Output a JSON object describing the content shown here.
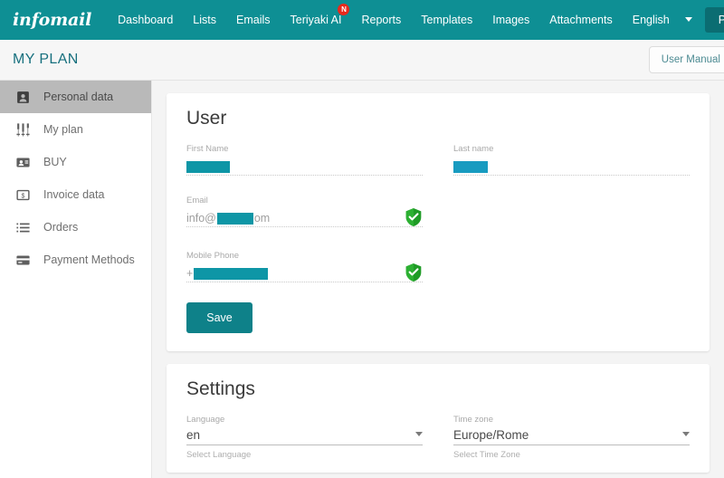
{
  "navbar": {
    "logo": "infomail",
    "items": [
      {
        "label": "Dashboard",
        "badge": ""
      },
      {
        "label": "Lists",
        "badge": ""
      },
      {
        "label": "Emails",
        "badge": ""
      },
      {
        "label": "Teriyaki AI",
        "badge": "N"
      },
      {
        "label": "Reports",
        "badge": ""
      },
      {
        "label": "Templates",
        "badge": ""
      },
      {
        "label": "Images",
        "badge": ""
      },
      {
        "label": "Attachments",
        "badge": ""
      },
      {
        "label": "English",
        "badge": ""
      }
    ],
    "profile_label": "Profile",
    "brand_color": "#0e8f94",
    "profile_color": "#0b6d72",
    "badge_color": "#e8291c"
  },
  "page_header": {
    "title": "MY PLAN",
    "manual_button": "User Manual",
    "title_color": "#17707e"
  },
  "sidebar": {
    "items": [
      {
        "label": "Personal data",
        "icon": "contact-card-icon",
        "active": true
      },
      {
        "label": "My plan",
        "icon": "sliders-icon",
        "active": false
      },
      {
        "label": "BUY",
        "icon": "id-card-icon",
        "active": false
      },
      {
        "label": "Invoice data",
        "icon": "dollar-box-icon",
        "active": false
      },
      {
        "label": "Orders",
        "icon": "list-icon",
        "active": false
      },
      {
        "label": "Payment Methods",
        "icon": "credit-card-icon",
        "active": false
      }
    ],
    "active_bg": "#b9b9b9"
  },
  "user_card": {
    "title": "User",
    "first_name": {
      "label": "First Name",
      "value": "",
      "redacted": true
    },
    "last_name": {
      "label": "Last name",
      "value": "",
      "redacted": true
    },
    "email": {
      "label": "Email",
      "value_prefix": "info@",
      "value_suffix": "om",
      "redacted": true,
      "verified": true,
      "verified_icon": "green-shield-check-icon"
    },
    "mobile_phone": {
      "label": "Mobile Phone",
      "value_prefix": "+",
      "value_suffix": "",
      "redacted": true,
      "verified": true,
      "verified_icon": "green-shield-check-icon"
    },
    "save_label": "Save",
    "save_color": "#0e8189",
    "redaction_color": "#0e96a6",
    "verified_color": "#1f9b26"
  },
  "settings_card": {
    "title": "Settings",
    "language": {
      "label": "Language",
      "value": "en",
      "hint": "Select Language"
    },
    "timezone": {
      "label": "Time zone",
      "value": "Europe/Rome",
      "hint": "Select Time Zone"
    }
  }
}
